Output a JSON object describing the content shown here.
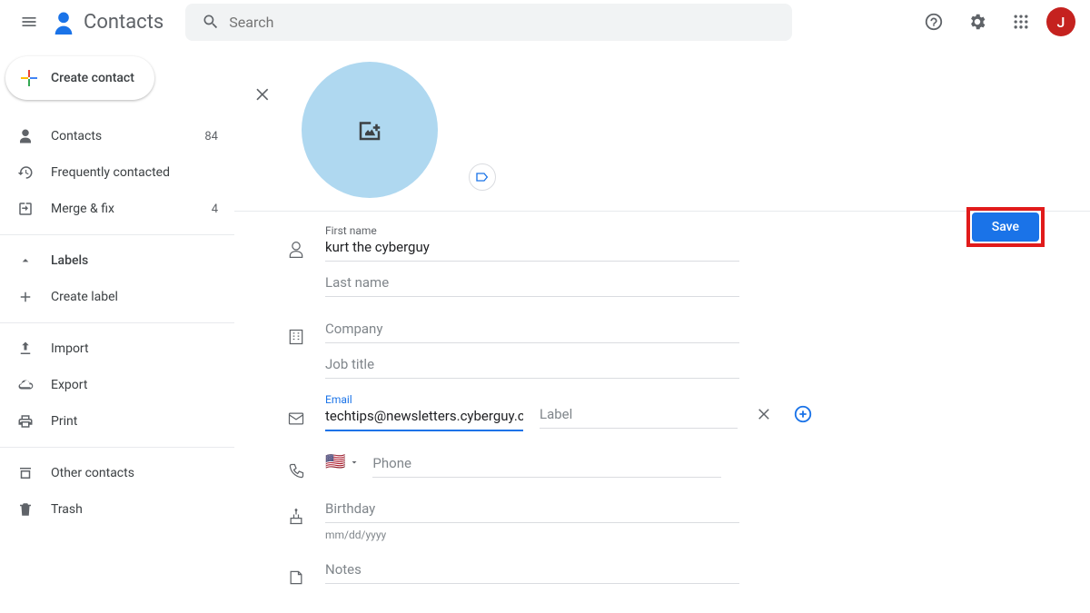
{
  "header": {
    "app_name": "Contacts",
    "search_placeholder": "Search",
    "avatar_initial": "J"
  },
  "sidebar": {
    "create_label": "Create contact",
    "contacts": {
      "label": "Contacts",
      "count": "84"
    },
    "frequent": {
      "label": "Frequently contacted"
    },
    "merge": {
      "label": "Merge & fix",
      "count": "4"
    },
    "labels_header": "Labels",
    "create_label_item": "Create label",
    "import": "Import",
    "export": "Export",
    "print": "Print",
    "other": "Other contacts",
    "trash": "Trash"
  },
  "edit": {
    "save_label": "Save",
    "first_name": {
      "label": "First name",
      "value": "kurt the cyberguy"
    },
    "last_name": {
      "placeholder": "Last name"
    },
    "company": {
      "placeholder": "Company"
    },
    "job_title": {
      "placeholder": "Job title"
    },
    "email": {
      "label": "Email",
      "value": "techtips@newsletters.cyberguy.com",
      "label_placeholder": "Label"
    },
    "phone": {
      "placeholder": "Phone",
      "flag": "🇺🇸"
    },
    "birthday": {
      "placeholder": "Birthday",
      "hint": "mm/dd/yyyy"
    },
    "notes": {
      "placeholder": "Notes"
    }
  }
}
